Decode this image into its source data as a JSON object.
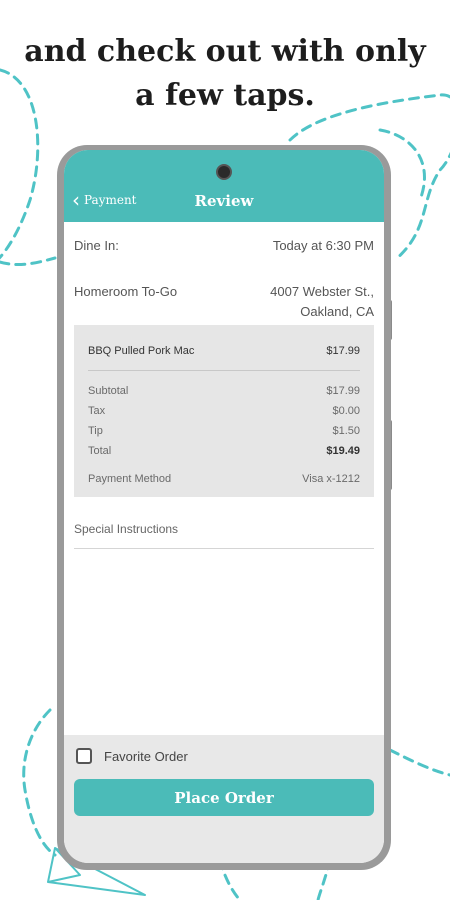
{
  "headline": {
    "line1": "and check out with only",
    "line2": "a few taps."
  },
  "nav": {
    "back_label": "Payment",
    "title": "Review"
  },
  "order": {
    "dine_label": "Dine In:",
    "dine_time": "Today at 6:30 PM",
    "restaurant": "Homeroom To-Go",
    "address_line1": "4007 Webster St.,",
    "address_line2": "Oakland, CA"
  },
  "summary": {
    "item_name": "BBQ Pulled Pork Mac",
    "item_price": "$17.99",
    "subtotal_label": "Subtotal",
    "subtotal": "$17.99",
    "tax_label": "Tax",
    "tax": "$0.00",
    "tip_label": "Tip",
    "tip": "$1.50",
    "total_label": "Total",
    "total": "$19.49",
    "payment_label": "Payment Method",
    "payment": "Visa x-1212"
  },
  "special_instructions_label": "Special Instructions",
  "favorite_label": "Favorite Order",
  "place_order_label": "Place Order",
  "colors": {
    "accent": "#4bbbb8",
    "dash": "#4fc3c6"
  }
}
